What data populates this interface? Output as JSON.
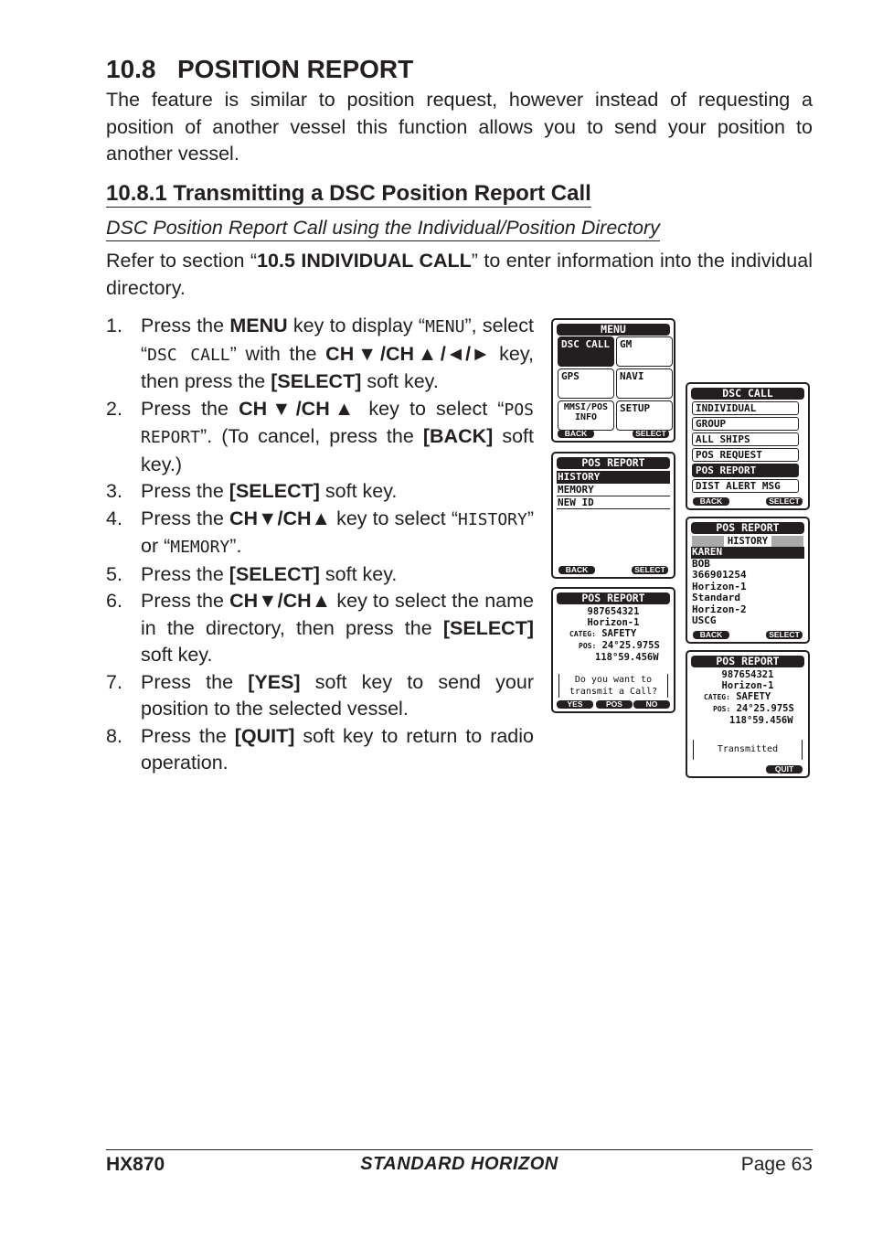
{
  "section": {
    "number": "10.8",
    "title": "POSITION REPORT"
  },
  "intro": "The feature is similar to position request, however instead of requesting a position of another vessel this function allows you to send your position to another vessel.",
  "subsection": "10.8.1  Transmitting a DSC Position Report Call",
  "subheading": "DSC Position Report Call using the Individual/Position Directory",
  "refer": [
    {
      "t": "Refer to section “"
    },
    {
      "t": "10.5 INDIVIDUAL CALL",
      "s": "b"
    },
    {
      "t": "” to enter information into the individual directory."
    }
  ],
  "steps": [
    {
      "n": "1.",
      "seg": [
        {
          "t": "Press the "
        },
        {
          "t": "MENU",
          "s": "b"
        },
        {
          "t": " key to display “"
        },
        {
          "t": "MENU",
          "s": "m"
        },
        {
          "t": "”, select “"
        },
        {
          "t": "DSC CALL",
          "s": "m"
        },
        {
          "t": "” with the "
        },
        {
          "t": "CH▼/CH▲/◄/►",
          "s": "b"
        },
        {
          "t": " key, then press the "
        },
        {
          "t": "[SELECT]",
          "s": "b"
        },
        {
          "t": " soft key."
        }
      ]
    },
    {
      "n": "2.",
      "seg": [
        {
          "t": "Press the "
        },
        {
          "t": "CH▼/CH▲",
          "s": "b"
        },
        {
          "t": " key to select “"
        },
        {
          "t": "POS REPORT",
          "s": "m"
        },
        {
          "t": "”. (To cancel, press the "
        },
        {
          "t": "[BACK]",
          "s": "b"
        },
        {
          "t": " soft key.)"
        }
      ]
    },
    {
      "n": "3.",
      "seg": [
        {
          "t": "Press the "
        },
        {
          "t": "[SELECT]",
          "s": "b"
        },
        {
          "t": " soft key."
        }
      ]
    },
    {
      "n": "4.",
      "seg": [
        {
          "t": "Press the "
        },
        {
          "t": "CH▼/CH▲",
          "s": "b"
        },
        {
          "t": " key to select “"
        },
        {
          "t": "HISTORY",
          "s": "m"
        },
        {
          "t": "” or “"
        },
        {
          "t": "MEMORY",
          "s": "m"
        },
        {
          "t": "”."
        }
      ]
    },
    {
      "n": "5.",
      "seg": [
        {
          "t": "Press the "
        },
        {
          "t": "[SELECT]",
          "s": "b"
        },
        {
          "t": " soft key."
        }
      ]
    },
    {
      "n": "6.",
      "seg": [
        {
          "t": "Press the "
        },
        {
          "t": "CH▼/CH▲",
          "s": "b"
        },
        {
          "t": " key to select the name in the directory, then press the "
        },
        {
          "t": "[SELECT]",
          "s": "b"
        },
        {
          "t": " soft key."
        }
      ]
    },
    {
      "n": "7.",
      "seg": [
        {
          "t": "Press the "
        },
        {
          "t": "[YES]",
          "s": "b"
        },
        {
          "t": " soft key to send your position to the selected vessel."
        }
      ]
    },
    {
      "n": "8.",
      "seg": [
        {
          "t": "Press the "
        },
        {
          "t": "[QUIT]",
          "s": "b"
        },
        {
          "t": " soft key to return to radio operation."
        }
      ]
    }
  ],
  "screens": {
    "menu": {
      "title": "MENU",
      "tiles": [
        "DSC CALL",
        "GM",
        "GPS",
        "NAVI",
        "MMSI/POS INFO",
        "SETUP"
      ],
      "back": "BACK",
      "select": "SELECT"
    },
    "dsc": {
      "title": "DSC CALL",
      "items": [
        "INDIVIDUAL",
        "GROUP",
        "ALL SHIPS",
        "POS REQUEST",
        "POS REPORT",
        "DIST ALERT MSG"
      ],
      "back": "BACK",
      "select": "SELECT"
    },
    "pos_list": {
      "title": "POS REPORT",
      "items": [
        "HISTORY",
        "MEMORY",
        "NEW ID"
      ],
      "back": "BACK",
      "select": "SELECT"
    },
    "history": {
      "title": "POS REPORT",
      "sub": "HISTORY",
      "items": [
        "KAREN",
        "BOB",
        "366901254",
        "Horizon-1",
        "Standard",
        "Horizon-2",
        "USCG"
      ],
      "back": "BACK",
      "select": "SELECT"
    },
    "confirm": {
      "title": "POS REPORT",
      "id": "987654321",
      "name": "Horizon-1",
      "categ_label": "CATEG:",
      "categ": "SAFETY",
      "pos_label": "POS:",
      "lat": "24°25.975S",
      "lon": "118°59.456W",
      "msg1": "Do you want to",
      "msg2": "transmit a Call?",
      "yes": "YES",
      "pos": "POS",
      "no": "NO"
    },
    "done": {
      "title": "POS REPORT",
      "id": "987654321",
      "name": "Horizon-1",
      "categ_label": "CATEG:",
      "categ": "SAFETY",
      "pos_label": "POS:",
      "lat": "24°25.975S",
      "lon": "118°59.456W",
      "msg": "Transmitted",
      "quit": "QUIT"
    }
  },
  "footer": {
    "model": "HX870",
    "logo": "STANDARD HORIZON",
    "page": "Page 63"
  }
}
